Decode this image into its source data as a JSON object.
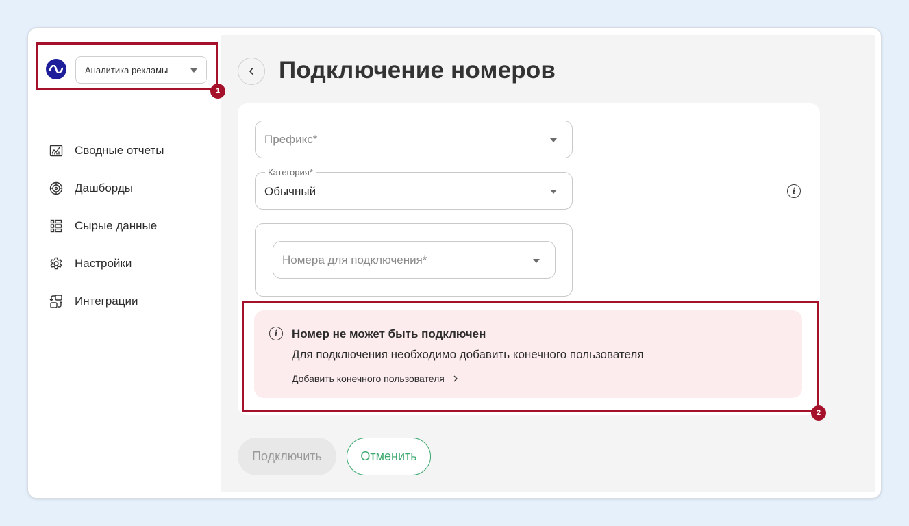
{
  "sidebar": {
    "app_selector": {
      "value": "Аналитика рекламы"
    },
    "items": [
      {
        "label": "Сводные отчеты",
        "icon": "report-chart-icon"
      },
      {
        "label": "Дашборды",
        "icon": "dashboard-icon"
      },
      {
        "label": "Сырые данные",
        "icon": "raw-data-icon"
      },
      {
        "label": "Настройки",
        "icon": "gear-icon"
      },
      {
        "label": "Интеграции",
        "icon": "integrations-icon"
      }
    ]
  },
  "header": {
    "title": "Подключение номеров"
  },
  "form": {
    "prefix": {
      "placeholder": "Префикс*"
    },
    "category": {
      "label": "Категория*",
      "value": "Обычный"
    },
    "numbers": {
      "placeholder": "Номера для подключения*"
    }
  },
  "alert": {
    "title": "Номер не может быть подключен",
    "text": "Для подключения необходимо добавить конечного пользователя",
    "link": "Добавить конечного пользователя"
  },
  "actions": {
    "connect": "Подключить",
    "cancel": "Отменить"
  },
  "annotations": {
    "badge1": "1",
    "badge2": "2"
  },
  "colors": {
    "highlight": "#a5102a",
    "accent_green": "#3aa76d",
    "alert_bg": "#fdeced",
    "logo": "#1e1e9a"
  }
}
